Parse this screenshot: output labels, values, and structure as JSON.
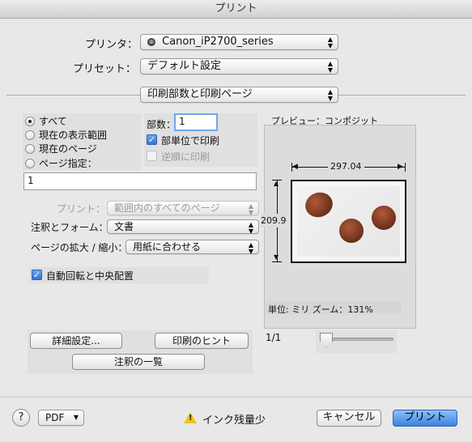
{
  "window": {
    "title": "プリント"
  },
  "header": {
    "printer_label": "プリンタ：",
    "printer_value": "Canon_iP2700_series",
    "preset_label": "プリセット：",
    "preset_value": "デフォルト設定",
    "section_value": "印刷部数と印刷ページ"
  },
  "pages": {
    "all": "すべて",
    "current_view": "現在の表示範囲",
    "current_page": "現在のページ",
    "specify": "ページ指定：",
    "range_value": "1",
    "selected": "all"
  },
  "copies": {
    "label": "部数：",
    "value": "1",
    "collate_label": "部単位で印刷",
    "collate_checked": true,
    "reverse_label": "逆順に印刷",
    "reverse_enabled": false
  },
  "options": {
    "print_label": "プリント：",
    "print_value": "範囲内のすべてのページ",
    "comments_label": "注釈とフォーム：",
    "comments_value": "文書",
    "scale_label": "ページの拡大 / 縮小：",
    "scale_value": "用紙に合わせる",
    "autorotate_label": "自動回転と中央配置",
    "autorotate_checked": true
  },
  "buttons": {
    "advanced": "詳細設定...",
    "hints": "印刷のヒント",
    "comments_list": "注釈の一覧"
  },
  "preview": {
    "title": "プレビュー：コンポジット",
    "width_label": "297.04",
    "height_label": "209.9",
    "units_zoom": "単位: ミリ ズーム：131%",
    "page_counter": "1/1"
  },
  "footer": {
    "help_symbol": "?",
    "pdf_label": "PDF",
    "ink_warning": "インク残量少",
    "cancel": "キャンセル",
    "print": "プリント"
  },
  "icons": {
    "printer_icon": "printer-status-icon",
    "warning": "warning-icon"
  },
  "colors": {
    "accent": "#3c82e0",
    "warning": "#f0c419"
  }
}
